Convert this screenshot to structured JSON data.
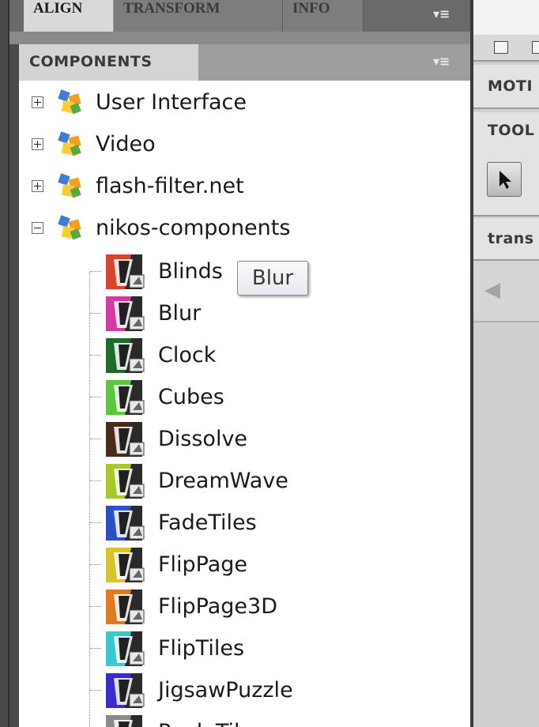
{
  "top_tabs": [
    {
      "label": "ALIGN",
      "active": true
    },
    {
      "label": "TRANSFORM",
      "active": false
    },
    {
      "label": "INFO",
      "active": false
    }
  ],
  "components_panel": {
    "title": "COMPONENTS",
    "categories": [
      {
        "label": "User Interface",
        "expanded": false
      },
      {
        "label": "Video",
        "expanded": false
      },
      {
        "label": "flash-filter.net",
        "expanded": false
      },
      {
        "label": "nikos-components",
        "expanded": true
      }
    ],
    "items": [
      {
        "label": "Blinds",
        "color": "#d8442a"
      },
      {
        "label": "Blur",
        "color": "#d43aa0"
      },
      {
        "label": "Clock",
        "color": "#1f6b2a"
      },
      {
        "label": "Cubes",
        "color": "#58c83c"
      },
      {
        "label": "Dissolve",
        "color": "#4a2a1a"
      },
      {
        "label": "DreamWave",
        "color": "#a8c82a"
      },
      {
        "label": "FadeTiles",
        "color": "#2a50c8"
      },
      {
        "label": "FlipPage",
        "color": "#d8c42a"
      },
      {
        "label": "FlipPage3D",
        "color": "#e07a20"
      },
      {
        "label": "FlipTiles",
        "color": "#3ac8d0"
      },
      {
        "label": "JigsawPuzzle",
        "color": "#3a2ad0"
      },
      {
        "label": "PagleTiles",
        "color": "#8a8a8a"
      }
    ]
  },
  "tooltip": {
    "text": "Blur"
  },
  "right_panel": {
    "sections": [
      "MOTI",
      "TOOL",
      "trans"
    ]
  },
  "icons": {
    "menu": "panel-menu-icon",
    "expand": "plus-box-icon",
    "collapse": "minus-box-icon",
    "category": "component-cube-icon",
    "component": "component-thumbnail-icon",
    "selection": "arrow-cursor-icon",
    "back": "back-arrow-icon"
  }
}
